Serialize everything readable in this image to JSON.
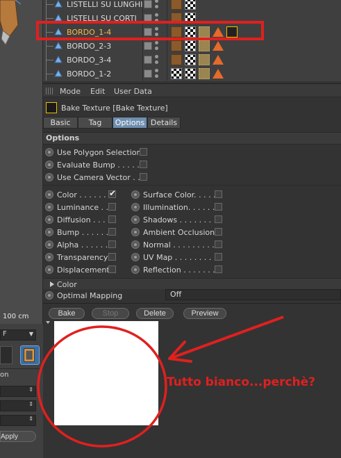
{
  "viewport": {
    "scale_label": "100 cm"
  },
  "left_panel": {
    "mode_select": "F",
    "section_label": "on",
    "apply_label": "Apply"
  },
  "object_list": {
    "rows": [
      {
        "name": "LISTELLI SU LUNGHI"
      },
      {
        "name": "LISTELLI SU CORTI"
      },
      {
        "name": "BORDO_1-4"
      },
      {
        "name": "BORDO_2-3"
      },
      {
        "name": "BORDO_3-4"
      },
      {
        "name": "BORDO_1-2"
      }
    ]
  },
  "attribute_manager": {
    "menu": [
      "Mode",
      "Edit",
      "User Data"
    ],
    "object_title": "Bake Texture [Bake Texture]",
    "tabs": [
      "Basic",
      "Tag",
      "Options",
      "Details"
    ],
    "active_tab": "Options",
    "section_header": "Options",
    "options": {
      "use_polygon_selection": "Use Polygon Selection",
      "evaluate_bump": "Evaluate Bump . . . . . .",
      "use_camera_vector": "Use Camera Vector . . ."
    },
    "channels_left": [
      "Color . . . . . .",
      "Luminance . .",
      "Diffusion . . . .",
      "Bump . . . . . .",
      "Alpha . . . . . .",
      "Transparency",
      "Displacement"
    ],
    "channels_right": [
      "Surface Color. . . . .",
      "Illumination. . . . . .",
      "Shadows . . . . . . .",
      "Ambient Occlusion",
      "Normal . . . . . . . . .",
      "UV Map . . . . . . . .",
      "Reflection . . . . . . ."
    ],
    "color_fold": "Color",
    "optimal_mapping": {
      "label": "Optimal Mapping",
      "value": "Off"
    },
    "buttons": {
      "bake": "Bake",
      "stop": "Stop",
      "delete": "Delete",
      "preview": "Preview"
    }
  },
  "annotation": {
    "text": "Tutto bianco...perchè?",
    "color": "#e0201f"
  }
}
